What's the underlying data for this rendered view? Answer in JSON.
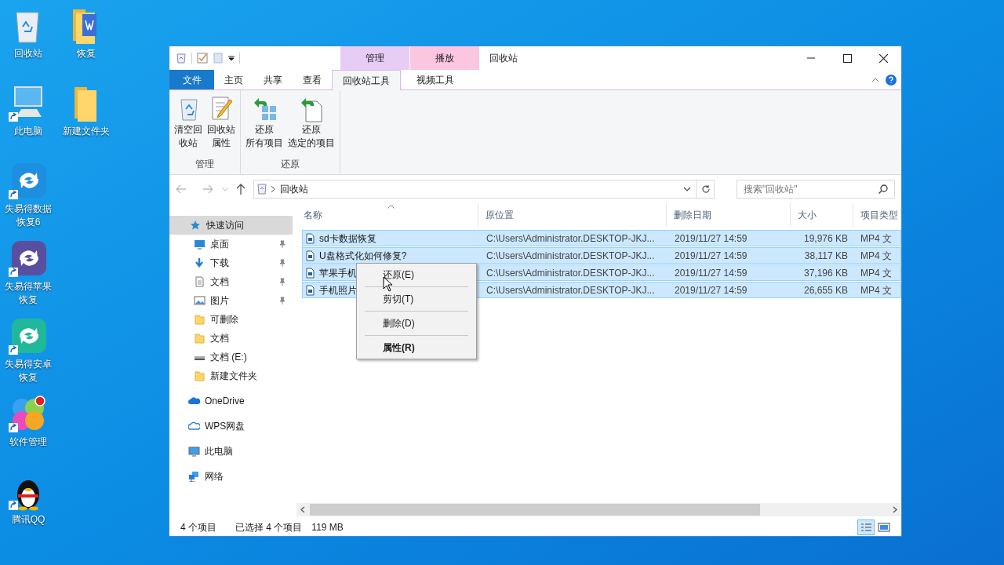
{
  "desktop": {
    "columns": [
      [
        {
          "label": "回收站",
          "kind": "recycle",
          "shortcut": false
        },
        {
          "label": "此电脑",
          "kind": "computer",
          "shortcut": true
        },
        {
          "label": "失易得数据恢复6",
          "kind": "app",
          "color": "#1e8fe0",
          "shortcut": true
        },
        {
          "label": "失易得苹果恢复",
          "kind": "app",
          "color": "#5a4ea0",
          "shortcut": true
        },
        {
          "label": "失易得安卓恢复",
          "kind": "app",
          "color": "#1fb89a",
          "shortcut": true
        },
        {
          "label": "软件管理",
          "kind": "petals",
          "shortcut": true
        },
        {
          "label": "腾讯QQ",
          "kind": "penguin",
          "shortcut": true
        }
      ],
      [
        {
          "label": "恢复",
          "kind": "docfolder",
          "shortcut": false
        },
        {
          "label": "新建文件夹",
          "kind": "folder",
          "shortcut": false
        }
      ]
    ]
  },
  "window": {
    "title": "回收站",
    "context_groups": [
      {
        "label": "管理",
        "color": "#e7ccf5"
      },
      {
        "label": "播放",
        "color": "#fbc6df"
      }
    ],
    "tabs": [
      {
        "label": "文件",
        "kind": "file",
        "selected": false
      },
      {
        "label": "主页",
        "kind": "tab",
        "selected": false
      },
      {
        "label": "共享",
        "kind": "tab",
        "selected": false
      },
      {
        "label": "查看",
        "kind": "tab",
        "selected": false
      },
      {
        "label": "回收站工具",
        "kind": "tab",
        "selected": true
      },
      {
        "label": "视频工具",
        "kind": "tab",
        "selected": false
      }
    ],
    "ribbon_groups": [
      {
        "label": "管理",
        "buttons": [
          {
            "lines": [
              "清空回",
              "收站"
            ],
            "kind": "recycle"
          },
          {
            "lines": [
              "回收站",
              "属性"
            ],
            "kind": "props"
          }
        ]
      },
      {
        "label": "还原",
        "buttons": [
          {
            "lines": [
              "还原",
              "所有项目"
            ],
            "kind": "restore-all"
          },
          {
            "lines": [
              "还原",
              "选定的项目"
            ],
            "kind": "restore-one"
          }
        ]
      }
    ],
    "address": {
      "path": "回收站",
      "search_placeholder": "搜索\"回收站\""
    },
    "nav": [
      {
        "label": "快速访问",
        "kind": "star",
        "selected": true,
        "pinned": false,
        "children": [
          {
            "label": "桌面",
            "kind": "desktop",
            "selected": false,
            "pinned": true
          },
          {
            "label": "下载",
            "kind": "download",
            "selected": false,
            "pinned": true
          },
          {
            "label": "文档",
            "kind": "doc",
            "selected": false,
            "pinned": true
          },
          {
            "label": "图片",
            "kind": "picture",
            "selected": false,
            "pinned": true
          },
          {
            "label": "可删除",
            "kind": "folder",
            "selected": false,
            "pinned": false
          },
          {
            "label": "文档",
            "kind": "folder",
            "selected": false,
            "pinned": false
          },
          {
            "label": "文档 (E:)",
            "kind": "drive",
            "selected": false,
            "pinned": false
          },
          {
            "label": "新建文件夹",
            "kind": "folder",
            "selected": false,
            "pinned": false
          }
        ]
      },
      {
        "label": "OneDrive",
        "kind": "cloud",
        "selected": false,
        "pinned": false
      },
      {
        "label": "WPS网盘",
        "kind": "cloud-outline",
        "selected": false,
        "pinned": false
      },
      {
        "label": "此电脑",
        "kind": "pc",
        "selected": false,
        "pinned": false
      },
      {
        "label": "网络",
        "kind": "network",
        "selected": false,
        "pinned": false
      }
    ],
    "table": {
      "columns": [
        "名称",
        "原位置",
        "删除日期",
        "大小",
        "项目类型"
      ],
      "rows": [
        {
          "name": "sd卡数据恢复",
          "location": "C:\\Users\\Administrator.DESKTOP-JKJ...",
          "date": "2019/11/27 14:59",
          "size": "19,976 KB",
          "type": "MP4 文",
          "selected": true
        },
        {
          "name": "U盘格式化如何修复?",
          "location": "C:\\Users\\Administrator.DESKTOP-JKJ...",
          "date": "2019/11/27 14:59",
          "size": "38,117 KB",
          "type": "MP4 文",
          "selected": true
        },
        {
          "name": "苹果手机",
          "location": "C:\\Users\\Administrator.DESKTOP-JKJ...",
          "date": "2019/11/27 14:59",
          "size": "37,196 KB",
          "type": "MP4 文",
          "selected": true
        },
        {
          "name": "手机照片",
          "location": "C:\\Users\\Administrator.DESKTOP-JKJ...",
          "date": "2019/11/27 14:59",
          "size": "26,655 KB",
          "type": "MP4 文",
          "selected": true
        }
      ]
    },
    "context_menu": [
      {
        "label": "还原(E)",
        "bold": false
      },
      {
        "label": "剪切(T)",
        "bold": false
      },
      {
        "label": "删除(D)",
        "bold": false
      },
      {
        "label": "属性(R)",
        "bold": true
      }
    ],
    "status_bar": {
      "count": "4 个项目",
      "selection": "已选择 4 个项目",
      "size": "119 MB"
    }
  }
}
